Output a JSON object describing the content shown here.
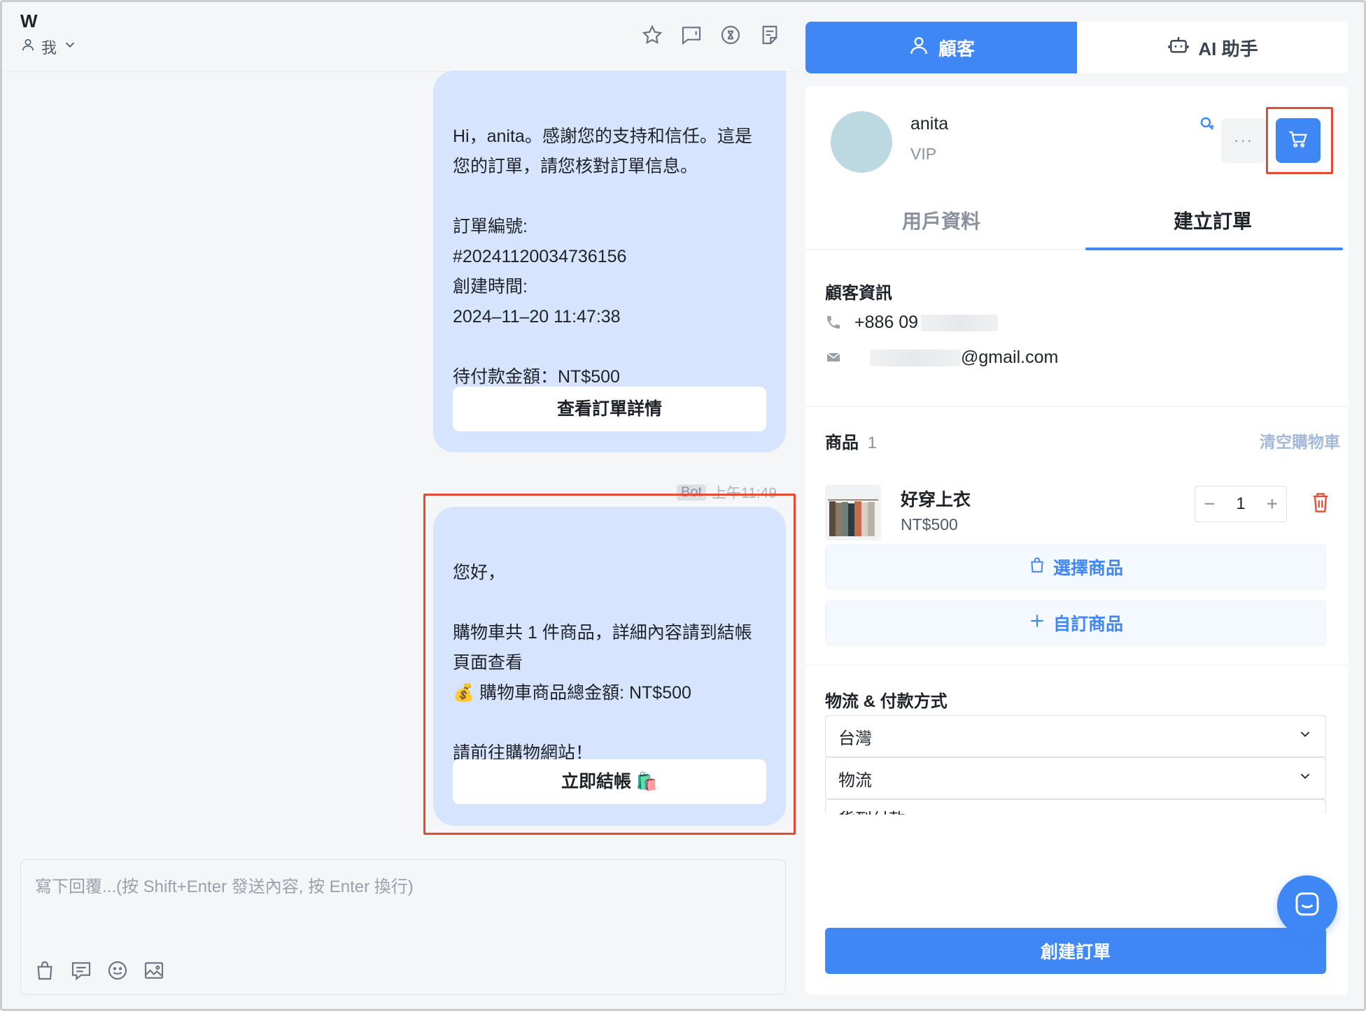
{
  "chat": {
    "title": "W",
    "assignee": "我",
    "messages": [
      {
        "text": "Hi，anita。感謝您的支持和信任。這是您的訂單，請您核對訂單信息。\n\n訂單編號:\n#20241120034736156\n創建時間:\n2024–11–20 11:47:38\n\n待付款金額：NT$500",
        "button": "查看訂單詳情"
      },
      {
        "sender_tag": "Bot",
        "time": "上午11:49",
        "text": "您好，\n\n購物車共 1 件商品，詳細內容請到結帳頁面查看\n💰 購物車商品總金額: NT$500\n\n請前往購物網站！",
        "button": "立即結帳 🛍️"
      }
    ],
    "composer_placeholder": "寫下回覆...(按 Shift+Enter 發送內容, 按 Enter 換行)",
    "composer_tools": [
      "bag-icon",
      "message-icon",
      "emoji-icon",
      "image-icon"
    ],
    "header_icons": [
      "star-icon",
      "comment-icon",
      "close-circle-icon",
      "note-icon"
    ]
  },
  "panel": {
    "tabs": [
      {
        "label": "顧客",
        "icon": "user-icon",
        "active": true
      },
      {
        "label": "AI 助手",
        "icon": "robot-icon",
        "active": false
      }
    ],
    "customer": {
      "name": "anita",
      "tier": "VIP",
      "more": "···"
    },
    "sub_tabs": [
      {
        "label": "用戶資料",
        "active": false
      },
      {
        "label": "建立訂單",
        "active": true
      }
    ],
    "customer_info": {
      "title": "顧客資訊",
      "phone_prefix": "+886 09",
      "email_suffix": "@gmail.com"
    },
    "products": {
      "title": "商品",
      "count": "1",
      "clear": "清空購物車",
      "items": [
        {
          "name": "好穿上衣",
          "price": "NT$500",
          "quantity": "1"
        }
      ],
      "choose_label": "選擇商品",
      "custom_label": "自訂商品"
    },
    "shipping": {
      "title": "物流 & 付款方式",
      "region": "台灣",
      "logistics": "物流",
      "payment_partial": "貨到付款"
    },
    "create_label": "創建訂單"
  },
  "colors": {
    "accent": "#3f87f5",
    "bubble": "#d6e4fe",
    "highlight": "#e34b33"
  }
}
